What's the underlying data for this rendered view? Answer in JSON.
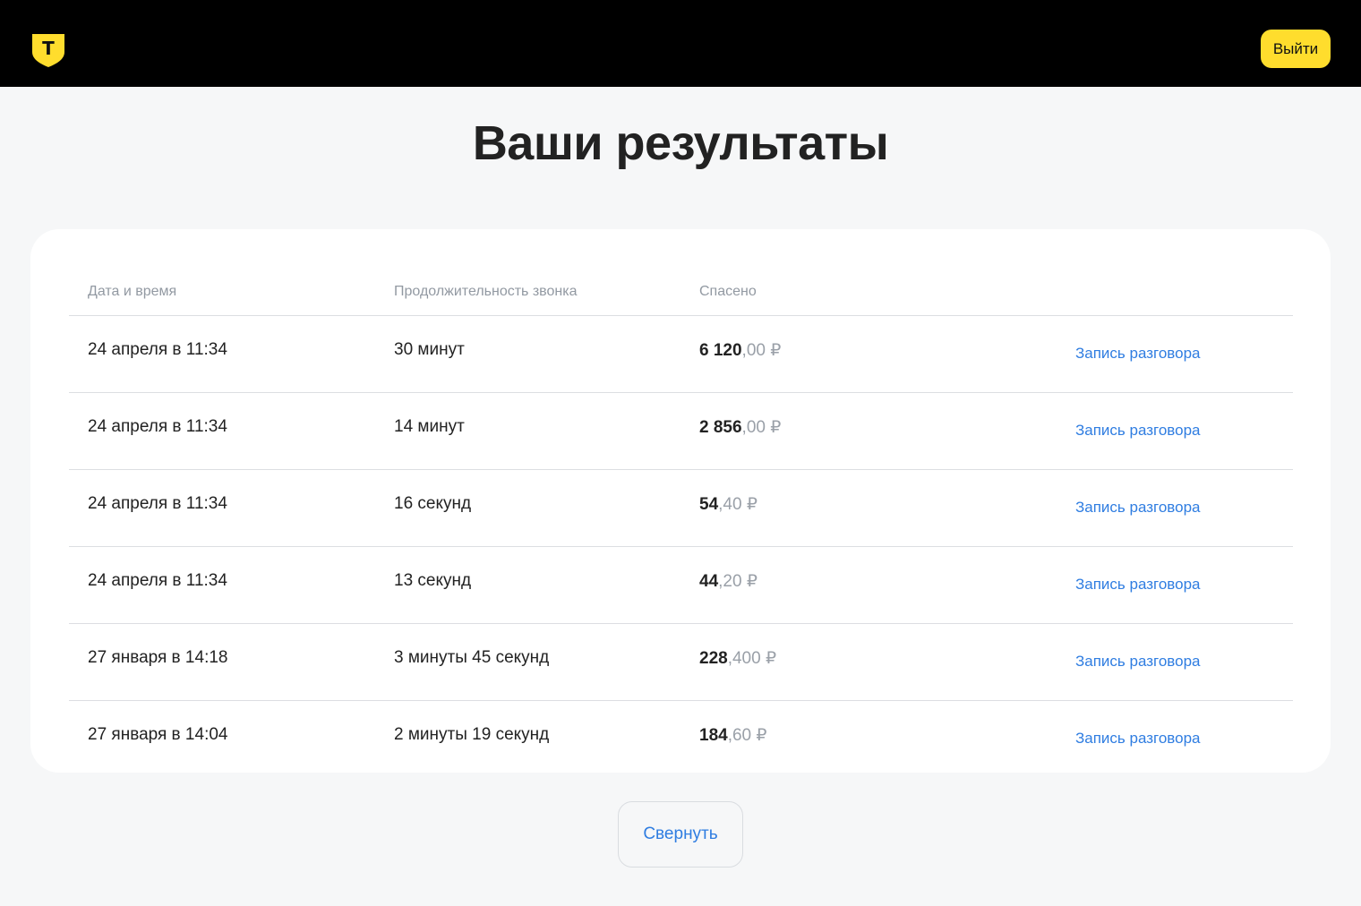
{
  "header": {
    "logo_icon": "tbank-shield-logo-icon",
    "logo_letter": "T",
    "logout_label": "Выйти",
    "brand_color": "#ffdd2d"
  },
  "main": {
    "title": "Ваши результаты",
    "table": {
      "columns": [
        "Дата и время",
        "Продолжительность звонка",
        "Спасено"
      ],
      "rows": [
        {
          "date": "24 апреля в 11:34",
          "duration": "30 минут",
          "saved_main": "6 120",
          "saved_frac": ",00 ₽",
          "link": "Запись разговора"
        },
        {
          "date": "24 апреля в 11:34",
          "duration": "14 минут",
          "saved_main": "2 856",
          "saved_frac": ",00 ₽",
          "link": "Запись разговора"
        },
        {
          "date": "24 апреля в 11:34",
          "duration": "16 секунд",
          "saved_main": "54",
          "saved_frac": ",40 ₽",
          "link": "Запись разговора"
        },
        {
          "date": "24 апреля в 11:34",
          "duration": "13 секунд",
          "saved_main": "44",
          "saved_frac": ",20 ₽",
          "link": "Запись разговора"
        },
        {
          "date": "27 января в 14:18",
          "duration": "3 минуты 45 секунд",
          "saved_main": "228",
          "saved_frac": ",400 ₽",
          "link": "Запись разговора"
        },
        {
          "date": "27 января в 14:04",
          "duration": "2 минуты 19 секунд",
          "saved_main": "184",
          "saved_frac": ",60 ₽",
          "link": "Запись разговора"
        }
      ]
    },
    "collapse_label": "Свернуть",
    "link_color": "#2f7de1"
  }
}
